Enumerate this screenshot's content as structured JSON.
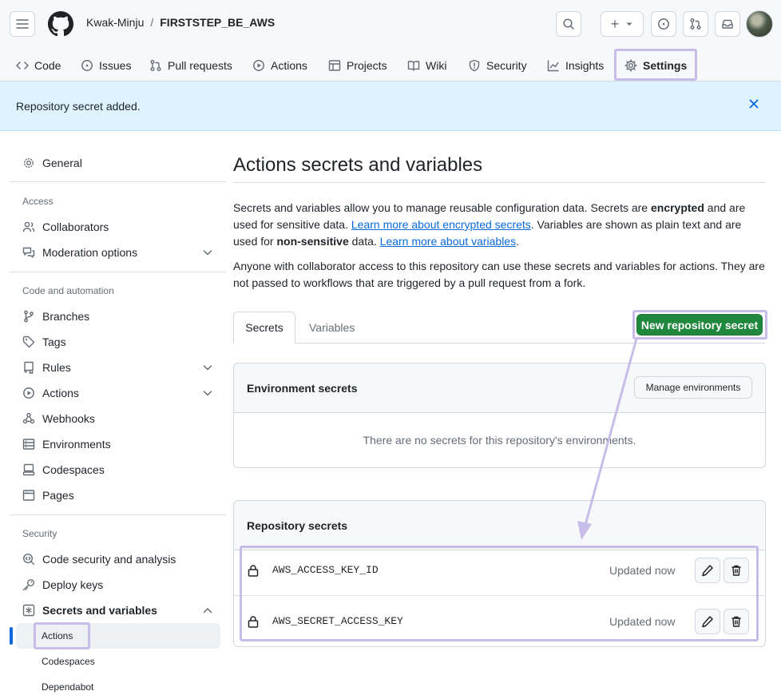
{
  "header": {
    "owner": "Kwak-Minju",
    "separator": "/",
    "repo": "FIRSTSTEP_BE_AWS",
    "plus_symbol": "+"
  },
  "tabs": [
    {
      "label": "Code",
      "icon": "code-icon"
    },
    {
      "label": "Issues",
      "icon": "issue-icon"
    },
    {
      "label": "Pull requests",
      "icon": "pull-request-icon"
    },
    {
      "label": "Actions",
      "icon": "play-icon"
    },
    {
      "label": "Projects",
      "icon": "table-icon"
    },
    {
      "label": "Wiki",
      "icon": "book-icon"
    },
    {
      "label": "Security",
      "icon": "shield-icon"
    },
    {
      "label": "Insights",
      "icon": "graph-icon"
    },
    {
      "label": "Settings",
      "icon": "gear-icon",
      "active": true
    }
  ],
  "flash": {
    "message": "Repository secret added."
  },
  "sidebar": {
    "general": "General",
    "access_heading": "Access",
    "collaborators": "Collaborators",
    "moderation": "Moderation options",
    "code_heading": "Code and automation",
    "branches": "Branches",
    "tags": "Tags",
    "rules": "Rules",
    "actions": "Actions",
    "webhooks": "Webhooks",
    "environments": "Environments",
    "codespaces": "Codespaces",
    "pages": "Pages",
    "security_heading": "Security",
    "code_security": "Code security and analysis",
    "deploy_keys": "Deploy keys",
    "secrets": "Secrets and variables",
    "sub_actions": "Actions",
    "sub_codespaces": "Codespaces",
    "sub_dependabot": "Dependabot"
  },
  "main": {
    "title": "Actions secrets and variables",
    "p1_a": "Secrets and variables allow you to manage reusable configuration data. Secrets are ",
    "p1_b": "encrypted",
    "p1_c": " and are used for sensitive data. ",
    "p1_link1": "Learn more about encrypted secrets",
    "p1_d": ". Variables are shown as plain text and are used for ",
    "p1_e": "non-sensitive",
    "p1_f": " data. ",
    "p1_link2": "Learn more about variables",
    "p1_g": ".",
    "p2": "Anyone with collaborator access to this repository can use these secrets and variables for actions. They are not passed to workflows that are triggered by a pull request from a fork.",
    "tab_secrets": "Secrets",
    "tab_variables": "Variables",
    "new_secret_button": "New repository secret",
    "env_title": "Environment secrets",
    "manage_env_button": "Manage environments",
    "env_empty": "There are no secrets for this repository's environments.",
    "repo_title": "Repository secrets",
    "secrets": [
      {
        "name": "AWS_ACCESS_KEY_ID",
        "updated": "Updated now"
      },
      {
        "name": "AWS_SECRET_ACCESS_KEY",
        "updated": "Updated now"
      }
    ]
  },
  "colors": {
    "primary_button": "#1f883d",
    "flash_bg": "#ddf4ff",
    "link": "#0969da",
    "highlight": "#c8bde8"
  }
}
